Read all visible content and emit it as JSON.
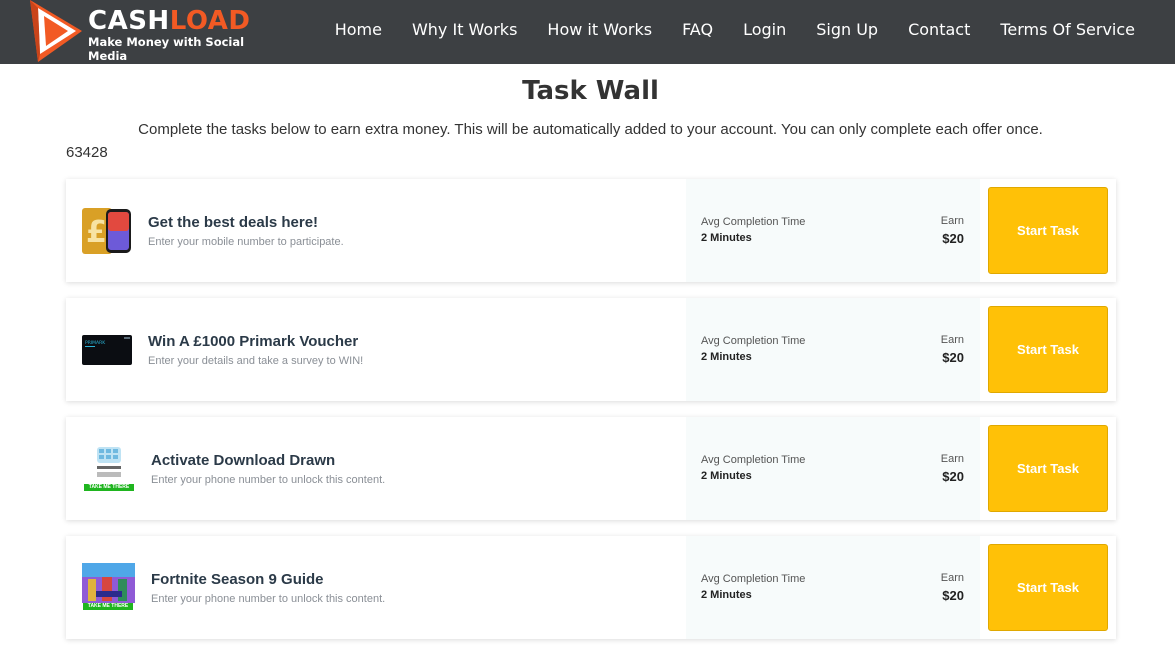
{
  "brand": {
    "word_part1": "CASH",
    "word_part2": "LOAD",
    "tagline": "Make Money with Social Media",
    "accent": "#f25a24"
  },
  "nav": {
    "items": [
      {
        "label": "Home"
      },
      {
        "label": "Why It Works"
      },
      {
        "label": "How it Works"
      },
      {
        "label": "FAQ"
      },
      {
        "label": "Login"
      },
      {
        "label": "Sign Up"
      },
      {
        "label": "Contact"
      },
      {
        "label": "Terms Of Service"
      }
    ]
  },
  "page": {
    "title": "Task Wall",
    "intro": "Complete the tasks below to earn extra money. This will be automatically added to your account. You can only complete each offer once.",
    "counter": "63428"
  },
  "tasks": [
    {
      "name": "Get the best deals here!",
      "description": "Enter your mobile number to participate.",
      "thumb_icon": "phone-deal-icon",
      "time_label": "Avg Completion Time",
      "time_value": "2 Minutes",
      "earn_label": "Earn",
      "earn_value": "$20",
      "button_label": "Start Task"
    },
    {
      "name": "Win A £1000 Primark Voucher",
      "description": "Enter your details and take a survey to WIN!",
      "thumb_icon": "primark-card-icon",
      "thumb_text": "PRIMARK",
      "time_label": "Avg Completion Time",
      "time_value": "2 Minutes",
      "earn_label": "Earn",
      "earn_value": "$20",
      "button_label": "Start Task"
    },
    {
      "name": "Activate Download Drawn",
      "description": "Enter your phone number to unlock this content.",
      "thumb_icon": "drawn-app-icon",
      "thumb_badge": "TAKE ME THERE",
      "time_label": "Avg Completion Time",
      "time_value": "2 Minutes",
      "earn_label": "Earn",
      "earn_value": "$20",
      "button_label": "Start Task"
    },
    {
      "name": "Fortnite Season 9 Guide",
      "description": "Enter your phone number to unlock this content.",
      "thumb_icon": "fortnite-guide-icon",
      "thumb_badge": "TAKE ME THERE",
      "time_label": "Avg Completion Time",
      "time_value": "2 Minutes",
      "earn_label": "Earn",
      "earn_value": "$20",
      "button_label": "Start Task"
    }
  ],
  "colors": {
    "header_bg": "#3d4043",
    "button": "#ffc107",
    "panel": "#f7fbfb"
  }
}
